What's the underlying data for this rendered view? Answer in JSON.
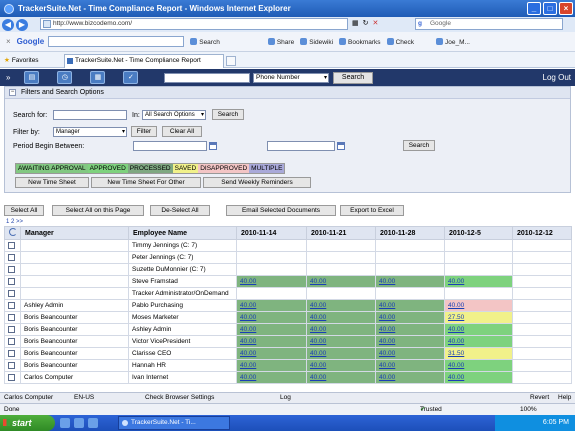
{
  "window": {
    "title": "TrackerSuite.Net - Time Compliance Report - Windows Internet Explorer",
    "url": "http://www.bizcodemo.com/",
    "search_placeholder": "Google"
  },
  "google_toolbar": {
    "logo": "Google",
    "items": [
      "Search",
      "Share",
      "Sidewiki",
      "Bookmarks",
      "Check",
      "Joe_M..."
    ]
  },
  "favorites": {
    "label": "Favorites",
    "tab_title": "TrackerSuite.Net - Time Compliance Report"
  },
  "app_header": {
    "select_value": "Phone Number",
    "search_label": "Search",
    "logout_label": "Log Out"
  },
  "filters": {
    "title": "Filters and Search Options",
    "search_for_label": "Search for:",
    "in_label": "In:",
    "in_select": "All Search Options",
    "search_btn": "Search",
    "filter_by_label": "Filter by:",
    "filter_by_select": "Manager",
    "filter_btn": "Filter",
    "clear_all_btn": "Clear All",
    "period_label": "Period Begin Between:",
    "search_btn2": "Search",
    "legend": [
      {
        "label": "AWAITING APPROVAL",
        "color": "#82c882"
      },
      {
        "label": "APPROVED",
        "color": "#7ed27e"
      },
      {
        "label": "PROCESSED",
        "color": "#7fa882"
      },
      {
        "label": "SAVED",
        "color": "#f1f18a"
      },
      {
        "label": "DISAPPROVED",
        "color": "#f3c5c5"
      },
      {
        "label": "MULTIPLE",
        "color": "#a9a9d9"
      }
    ],
    "new_time_sheet_btn": "New Time Sheet",
    "new_time_sheet_other_btn": "New Time Sheet For Other",
    "send_reminders_btn": "Send Weekly Reminders"
  },
  "actions": {
    "select_all": "Select All",
    "select_all_page": "Select All on this Page",
    "deselect_all": "De-Select All",
    "email_selected": "Email Selected Documents",
    "export_excel": "Export to Excel"
  },
  "pager": "1 2 >>",
  "table": {
    "headers": [
      "",
      "Manager",
      "Employee Name",
      "2010-11-14",
      "2010-11-21",
      "2010-11-28",
      "2010-12-5",
      "2010-12-12"
    ],
    "rows": [
      {
        "manager": "",
        "employee": "Timmy Jennings (C: 7)",
        "cells": [
          "",
          "",
          "",
          "",
          ""
        ]
      },
      {
        "manager": "",
        "employee": "Peter Jennings (C: 7)",
        "cells": [
          "",
          "",
          "",
          "",
          ""
        ]
      },
      {
        "manager": "",
        "employee": "Suzette DuMonnier (C: 7)",
        "cells": [
          "",
          "",
          "",
          "",
          ""
        ]
      },
      {
        "manager": "",
        "employee": "Steve Framstad",
        "cells": [
          "40.00",
          "40.00",
          "40.00",
          "40.00",
          ""
        ]
      },
      {
        "manager": "",
        "employee": "Tracker Administrator/OnDemand",
        "cells": [
          "",
          "",
          "",
          "",
          ""
        ]
      },
      {
        "manager": "Ashley Admin",
        "employee": "Pablo Purchasing",
        "cells": [
          "40.00",
          "40.00",
          "40.00",
          "40.00",
          ""
        ]
      },
      {
        "manager": "Boris Beancounter",
        "employee": "Moses Marketer",
        "cells": [
          "40.00",
          "40.00",
          "40.00",
          "27.50",
          ""
        ]
      },
      {
        "manager": "Boris Beancounter",
        "employee": "Ashley Admin",
        "cells": [
          "40.00",
          "40.00",
          "40.00",
          "40.00",
          ""
        ]
      },
      {
        "manager": "Boris Beancounter",
        "employee": "Victor VicePresident",
        "cells": [
          "40.00",
          "40.00",
          "40.00",
          "40.00",
          ""
        ]
      },
      {
        "manager": "Boris Beancounter",
        "employee": "Clarisse CEO",
        "cells": [
          "40.00",
          "40.00",
          "40.00",
          "31.50",
          ""
        ]
      },
      {
        "manager": "Boris Beancounter",
        "employee": "Hannah HR",
        "cells": [
          "40.00",
          "40.00",
          "40.00",
          "40.00",
          ""
        ]
      },
      {
        "manager": "Carlos Computer",
        "employee": "Ivan Internet",
        "cells": [
          "40.00",
          "40.00",
          "40.00",
          "40.00",
          ""
        ]
      }
    ],
    "row_colors": [
      [
        "",
        "",
        "",
        "",
        ""
      ],
      [
        "",
        "",
        "",
        "",
        ""
      ],
      [
        "",
        "",
        "",
        "",
        ""
      ],
      [
        "#7fb47f",
        "#7fb47f",
        "#7fb47f",
        "#7ed27e",
        ""
      ],
      [
        "",
        "",
        "",
        "",
        ""
      ],
      [
        "#7fb47f",
        "#7fb47f",
        "#7fb47f",
        "#f3c5c5",
        ""
      ],
      [
        "#7fb47f",
        "#7fb47f",
        "#7fb47f",
        "#f1f18a",
        ""
      ],
      [
        "#7fb47f",
        "#7fb47f",
        "#7fb47f",
        "#7ed27e",
        ""
      ],
      [
        "#7fb47f",
        "#7fb47f",
        "#7fb47f",
        "#7ed27e",
        ""
      ],
      [
        "#7fb47f",
        "#7fb47f",
        "#7fb47f",
        "#f1f18a",
        ""
      ],
      [
        "#7fb47f",
        "#7fb47f",
        "#7fb47f",
        "#7ed27e",
        ""
      ],
      [
        "#7fb47f",
        "#7fb47f",
        "#7fb47f",
        "#7ed27e",
        ""
      ]
    ]
  },
  "app_status": {
    "user": "Carlos Computer",
    "locale": "EN-US",
    "check_settings": "Check Browser Settings",
    "log": "Log",
    "revert": "Revert",
    "help": "Help"
  },
  "ie_status": {
    "left": "Done",
    "zone": "Trusted sites",
    "zoom": "100%"
  },
  "taskbar": {
    "start": "start",
    "task": "TrackerSuite.Net - Ti...",
    "clock": "6:05 PM"
  }
}
